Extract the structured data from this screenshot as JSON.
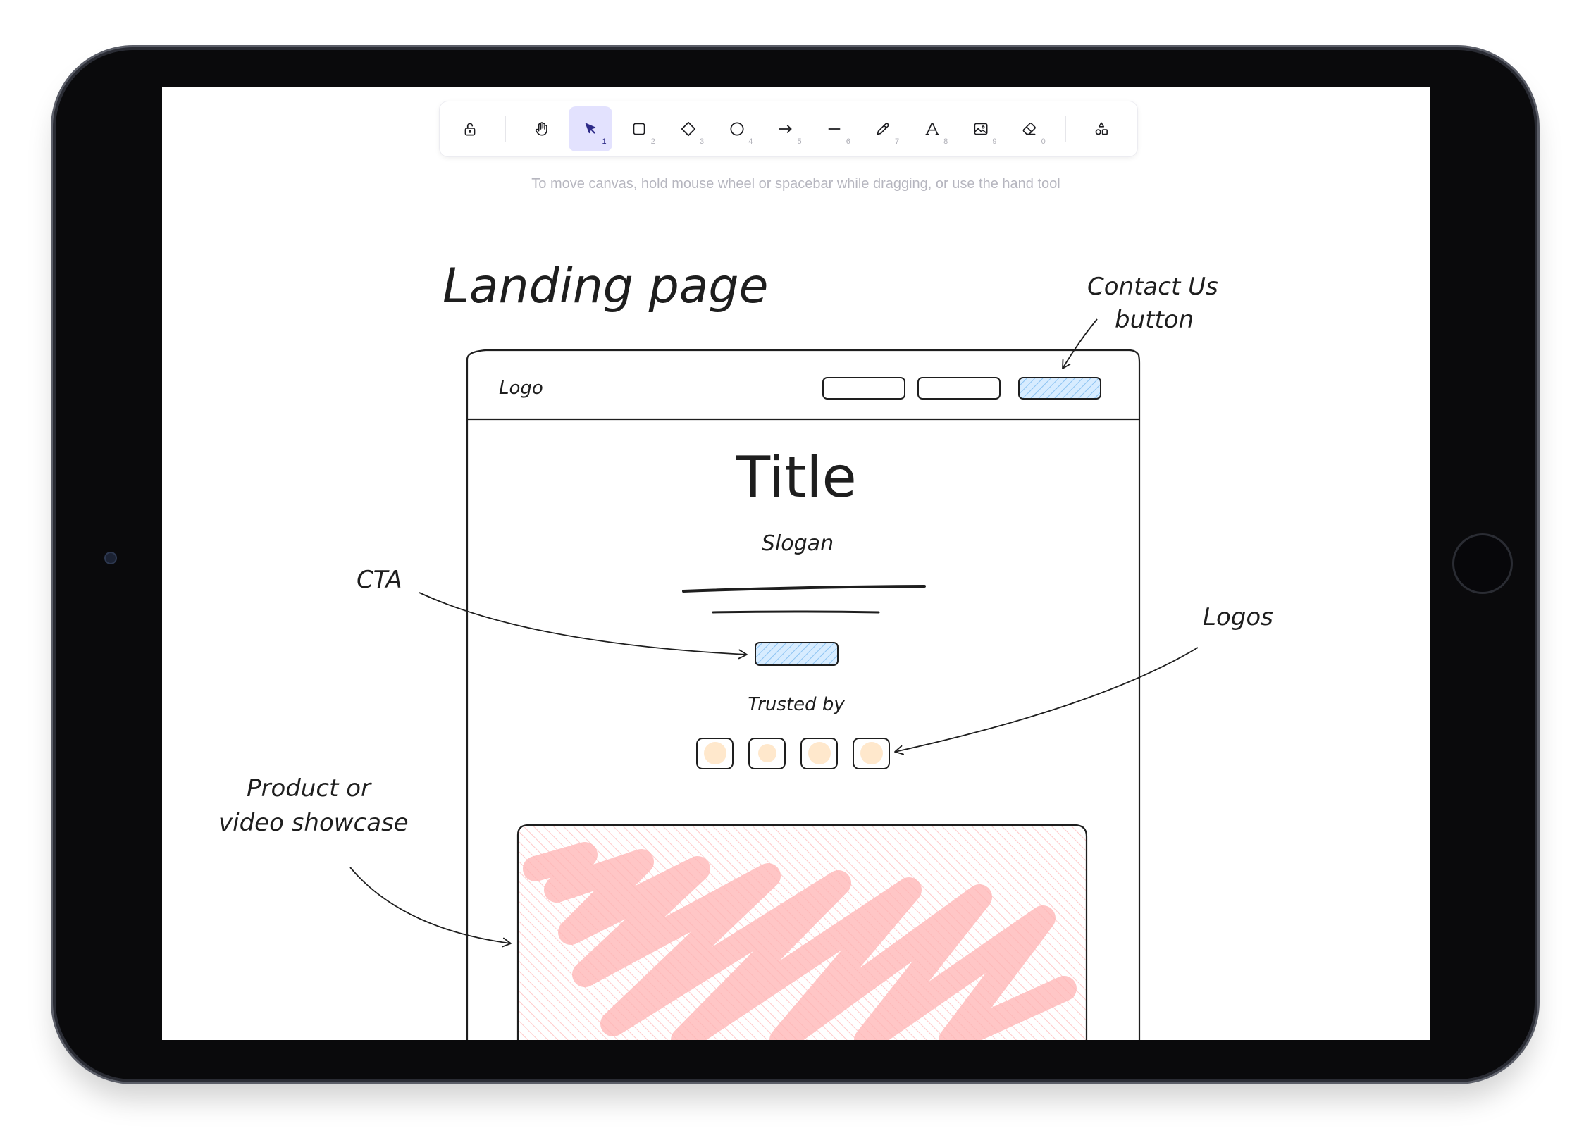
{
  "toolbar": {
    "tools": [
      {
        "name": "lock-icon",
        "key": ""
      },
      {
        "name": "hand-icon",
        "key": ""
      },
      {
        "name": "selection-icon",
        "key": "1"
      },
      {
        "name": "rectangle-icon",
        "key": "2"
      },
      {
        "name": "diamond-icon",
        "key": "3"
      },
      {
        "name": "ellipse-icon",
        "key": "4"
      },
      {
        "name": "arrow-icon",
        "key": "5"
      },
      {
        "name": "line-icon",
        "key": "6"
      },
      {
        "name": "pencil-icon",
        "key": "7"
      },
      {
        "name": "text-icon",
        "key": "8"
      },
      {
        "name": "image-icon",
        "key": "9"
      },
      {
        "name": "eraser-icon",
        "key": "0"
      },
      {
        "name": "shapes-library-icon",
        "key": ""
      }
    ],
    "active_tool": "selection-icon"
  },
  "hint": "To move canvas, hold mouse wheel or spacebar while dragging, or use the hand tool",
  "drawing": {
    "heading": "Landing page",
    "logo": "Logo",
    "title": "Title",
    "slogan": "Slogan",
    "trusted_by": "Trusted by",
    "annotation_cta": "CTA",
    "annotation_contact_line1": "Contact Us",
    "annotation_contact_line2": "button",
    "annotation_logos": "Logos",
    "annotation_product_line1": "Product or",
    "annotation_product_line2": "video showcase"
  },
  "colors": {
    "accent": "#e3e2fe",
    "accent_text": "#2e2b88",
    "ink": "#1e1e1e",
    "button_fill": "#a5d8ff",
    "logo_fill": "#ffe8cc",
    "showcase_fill": "#ffc9c9"
  }
}
